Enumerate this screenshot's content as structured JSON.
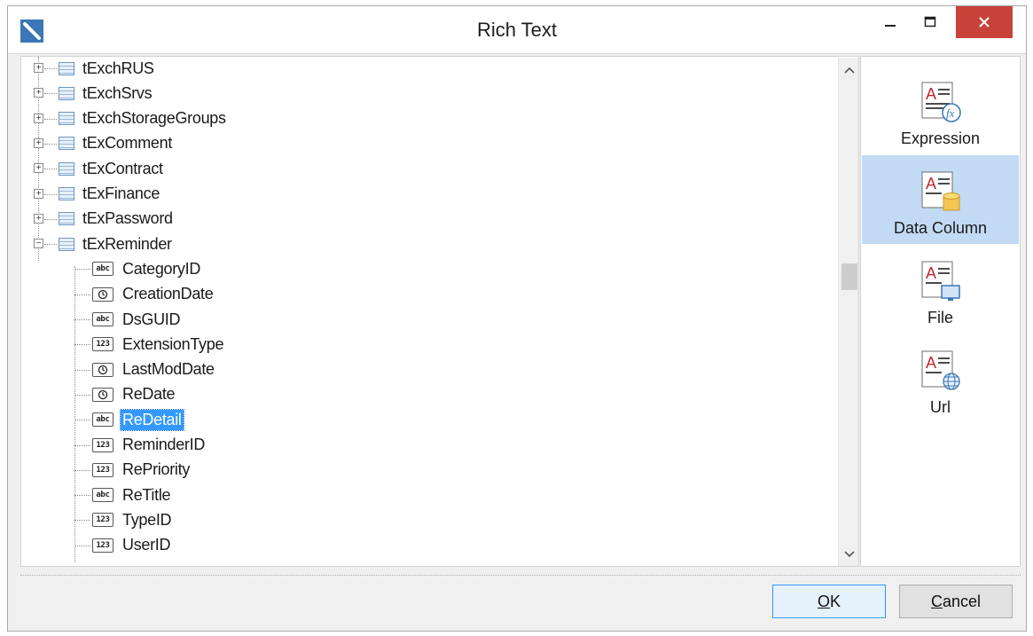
{
  "window": {
    "title": "Rich Text"
  },
  "tree": {
    "tables": [
      {
        "label": "tExchRUS",
        "icon": "table-icon",
        "expanded": false
      },
      {
        "label": "tExchSrvs",
        "icon": "table-icon",
        "expanded": false
      },
      {
        "label": "tExchStorageGroups",
        "icon": "table-icon",
        "expanded": false
      },
      {
        "label": "tExComment",
        "icon": "table-icon",
        "expanded": false
      },
      {
        "label": "tExContract",
        "icon": "table-icon",
        "expanded": false
      },
      {
        "label": "tExFinance",
        "icon": "table-icon",
        "expanded": false
      },
      {
        "label": "tExPassword",
        "icon": "table-icon",
        "expanded": false
      },
      {
        "label": "tExReminder",
        "icon": "table-icon",
        "expanded": true
      }
    ],
    "fields": [
      {
        "label": "CategoryID",
        "type_badge": "abc",
        "icon": "string-field-icon"
      },
      {
        "label": "CreationDate",
        "type_badge": "",
        "icon": "datetime-field-icon"
      },
      {
        "label": "DsGUID",
        "type_badge": "abc",
        "icon": "string-field-icon"
      },
      {
        "label": "ExtensionType",
        "type_badge": "123",
        "icon": "number-field-icon"
      },
      {
        "label": "LastModDate",
        "type_badge": "",
        "icon": "datetime-field-icon"
      },
      {
        "label": "ReDate",
        "type_badge": "",
        "icon": "datetime-field-icon"
      },
      {
        "label": "ReDetail",
        "type_badge": "abc",
        "icon": "string-field-icon",
        "selected": true
      },
      {
        "label": "ReminderID",
        "type_badge": "123",
        "icon": "number-field-icon"
      },
      {
        "label": "RePriority",
        "type_badge": "123",
        "icon": "number-field-icon"
      },
      {
        "label": "ReTitle",
        "type_badge": "abc",
        "icon": "string-field-icon"
      },
      {
        "label": "TypeID",
        "type_badge": "123",
        "icon": "number-field-icon"
      },
      {
        "label": "UserID",
        "type_badge": "123",
        "icon": "number-field-icon"
      }
    ]
  },
  "sources": [
    {
      "label": "Expression",
      "icon": "expression-icon",
      "active": false
    },
    {
      "label": "Data Column",
      "icon": "data-column-icon",
      "active": true
    },
    {
      "label": "File",
      "icon": "file-icon",
      "active": false
    },
    {
      "label": "Url",
      "icon": "url-icon",
      "active": false
    }
  ],
  "buttons": {
    "ok_label": "OK",
    "ok_mnemonic": "O",
    "ok_rest": "K",
    "cancel_label": "Cancel",
    "cancel_mnemonic": "C",
    "cancel_rest": "ancel"
  },
  "colors": {
    "selection": "#3399ff",
    "active_source": "#c2daf4",
    "close_button": "#c7433a"
  }
}
